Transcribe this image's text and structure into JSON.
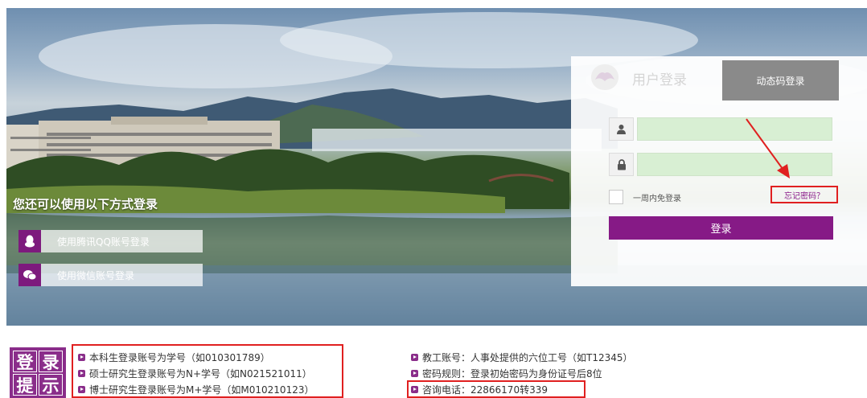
{
  "brand_color": "#861a86",
  "alert_color": "#e02020",
  "hero": {
    "alt_title": "您还可以使用以下方式登录",
    "alt_methods": [
      {
        "icon": "qq-penguin-icon",
        "label": "使用腾讯QQ账号登录"
      },
      {
        "icon": "wechat-icon",
        "label": "使用微信账号登录"
      }
    ]
  },
  "login": {
    "tab_user": "用户登录",
    "tab_dynamic": "动态码登录",
    "username_icon": "user-icon",
    "password_icon": "lock-icon",
    "username_value": "",
    "password_value": "",
    "remember_label": "一周内免登录",
    "forgot_label": "忘记密码？",
    "submit_label": "登录"
  },
  "tips": {
    "logo_chars": [
      "登",
      "录",
      "提",
      "示"
    ],
    "left": [
      "本科生登录账号为学号（如010301789）",
      "硕士研究生登录账号为N+学号（如N021521011）",
      "博士研究生登录账号为M+学号（如M010210123）"
    ],
    "right": [
      "教工账号：人事处提供的六位工号（如T12345）",
      "密码规则：登录初始密码为身份证号后8位",
      "咨询电话：22866170转339"
    ]
  }
}
